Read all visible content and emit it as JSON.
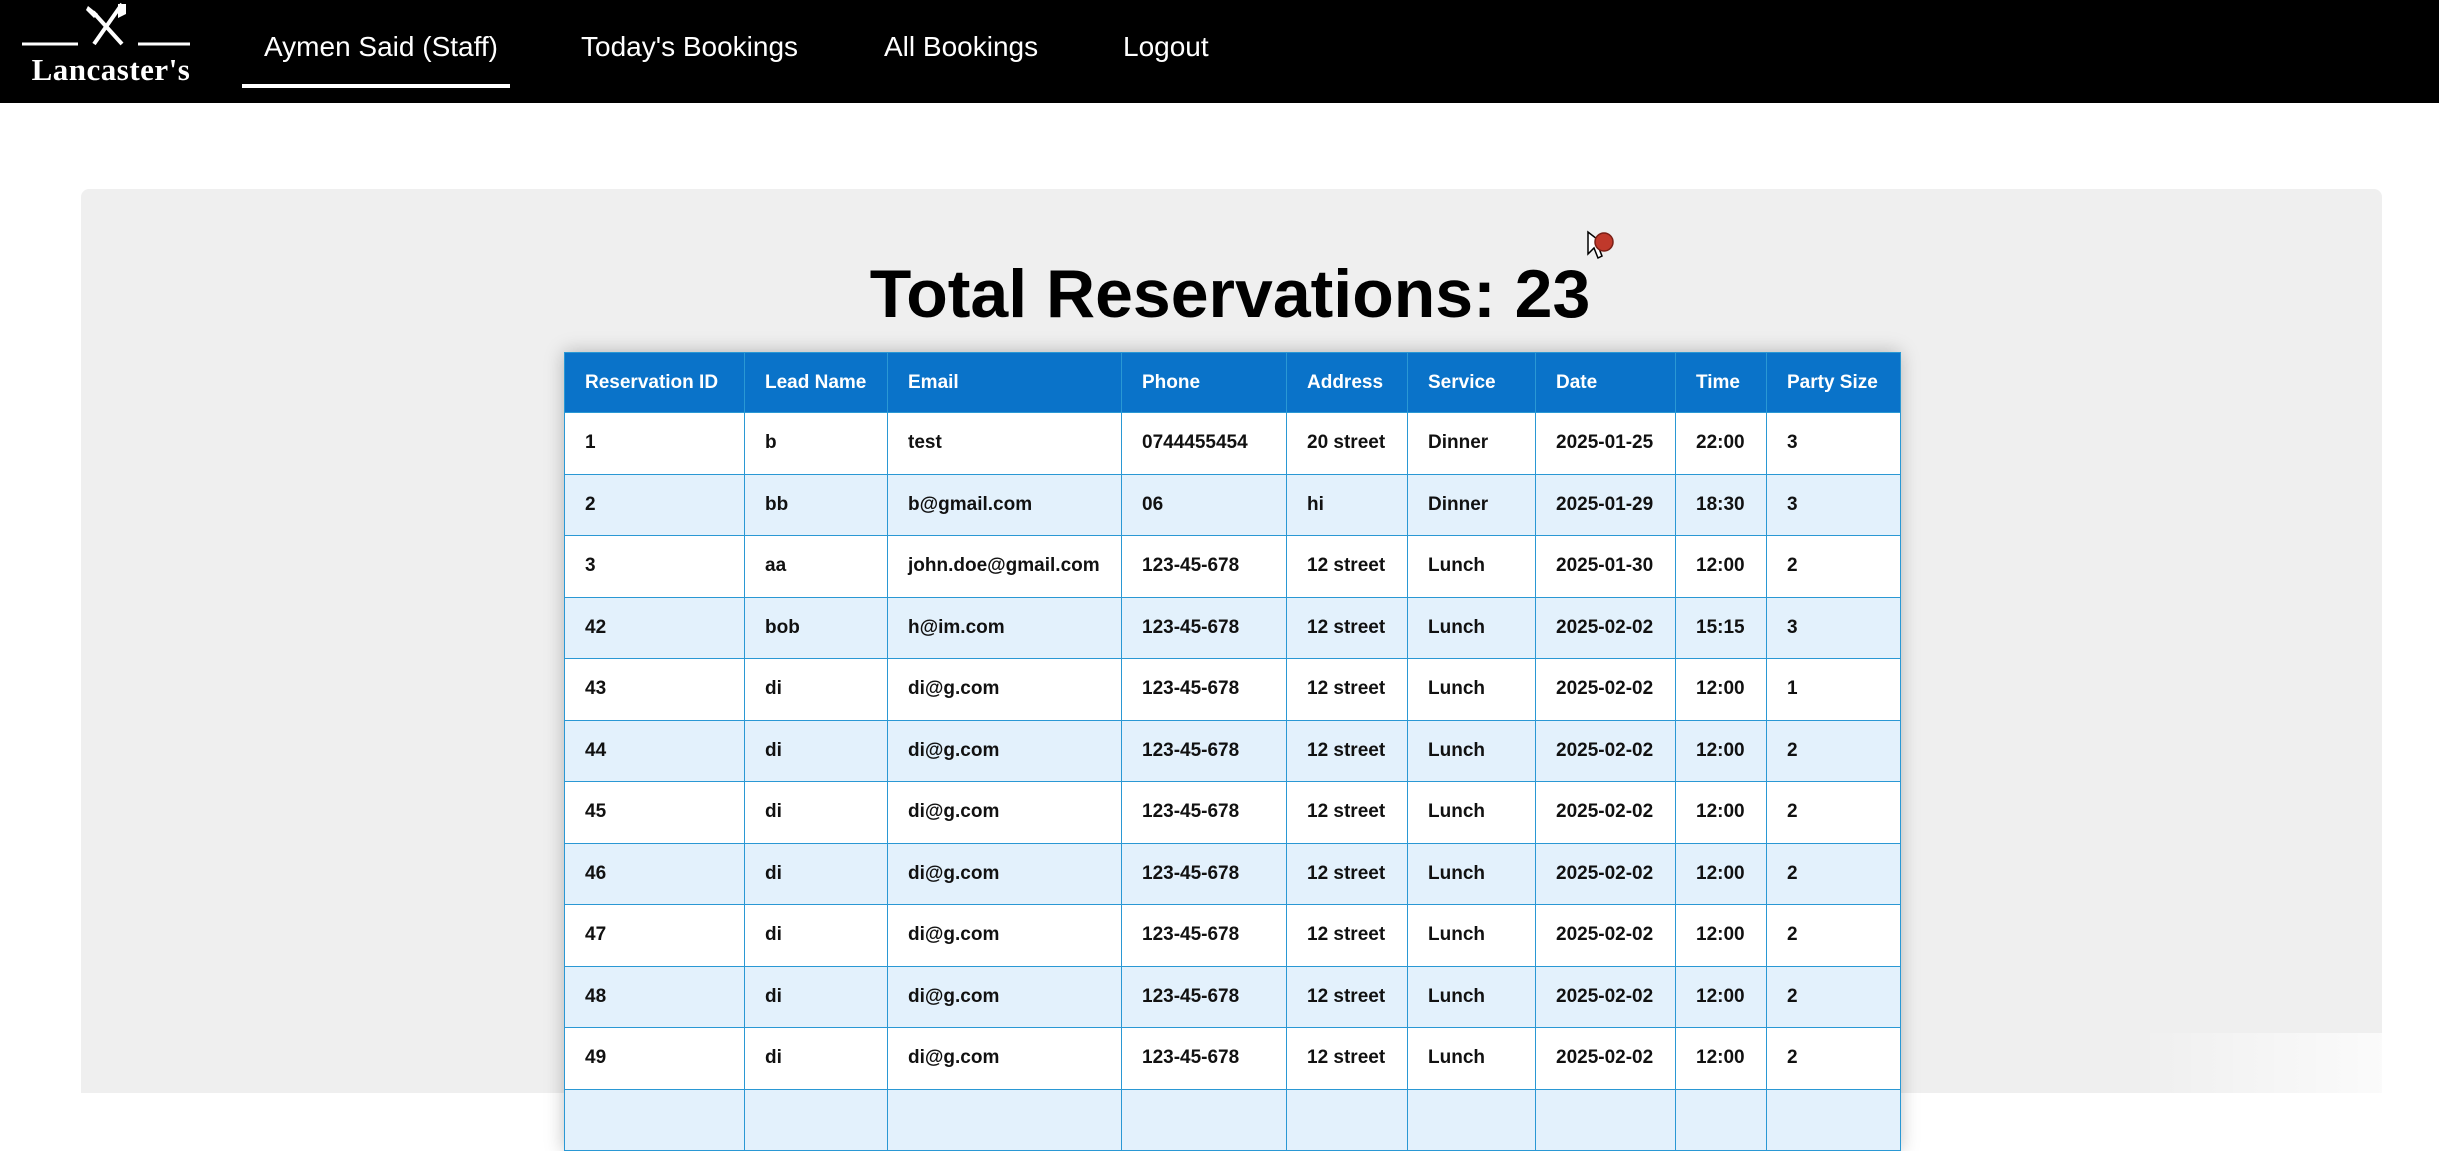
{
  "brand": {
    "logo_text": "Lancaster's",
    "logo_icon": "fork-knife-icon"
  },
  "nav": {
    "items": [
      {
        "label": "Aymen Said (Staff)",
        "active": true
      },
      {
        "label": "Today's Bookings",
        "active": false
      },
      {
        "label": "All Bookings",
        "active": false
      },
      {
        "label": "Logout",
        "active": false
      }
    ]
  },
  "main": {
    "title": "Total Reservations: 23"
  },
  "table": {
    "headers": [
      "Reservation ID",
      "Lead Name",
      "Email",
      "Phone",
      "Address",
      "Service",
      "Date",
      "Time",
      "Party Size"
    ],
    "rows": [
      [
        "1",
        "b",
        "test",
        "0744455454",
        "20 street",
        "Dinner",
        "2025-01-25",
        "22:00",
        "3"
      ],
      [
        "2",
        "bb",
        "b@gmail.com",
        "06",
        "hi",
        "Dinner",
        "2025-01-29",
        "18:30",
        "3"
      ],
      [
        "3",
        "aa",
        "john.doe@gmail.com",
        "123-45-678",
        "12 street",
        "Lunch",
        "2025-01-30",
        "12:00",
        "2"
      ],
      [
        "42",
        "bob",
        "h@im.com",
        "123-45-678",
        "12 street",
        "Lunch",
        "2025-02-02",
        "15:15",
        "3"
      ],
      [
        "43",
        "di",
        "di@g.com",
        "123-45-678",
        "12 street",
        "Lunch",
        "2025-02-02",
        "12:00",
        "1"
      ],
      [
        "44",
        "di",
        "di@g.com",
        "123-45-678",
        "12 street",
        "Lunch",
        "2025-02-02",
        "12:00",
        "2"
      ],
      [
        "45",
        "di",
        "di@g.com",
        "123-45-678",
        "12 street",
        "Lunch",
        "2025-02-02",
        "12:00",
        "2"
      ],
      [
        "46",
        "di",
        "di@g.com",
        "123-45-678",
        "12 street",
        "Lunch",
        "2025-02-02",
        "12:00",
        "2"
      ],
      [
        "47",
        "di",
        "di@g.com",
        "123-45-678",
        "12 street",
        "Lunch",
        "2025-02-02",
        "12:00",
        "2"
      ],
      [
        "48",
        "di",
        "di@g.com",
        "123-45-678",
        "12 street",
        "Lunch",
        "2025-02-02",
        "12:00",
        "2"
      ],
      [
        "49",
        "di",
        "di@g.com",
        "123-45-678",
        "12 street",
        "Lunch",
        "2025-02-02",
        "12:00",
        "2"
      ],
      [
        "",
        "",
        "",
        "",
        "",
        "",
        "",
        "",
        ""
      ]
    ]
  },
  "colors": {
    "nav_bg": "#000000",
    "header_bg": "#0a73c9",
    "row_alt_bg": "#e3f1fc",
    "panel_bg": "#efefef"
  }
}
